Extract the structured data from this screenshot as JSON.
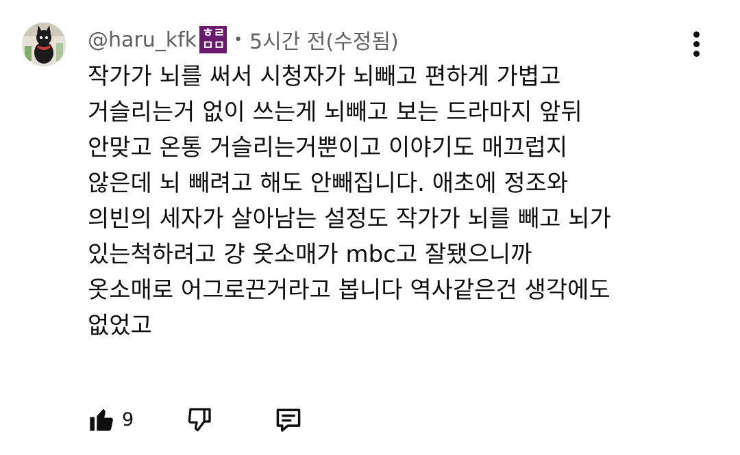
{
  "comment": {
    "author": "@haru_kfk",
    "badge": [
      "ㅎㄹ",
      "ㅁㅁ"
    ],
    "separator": "•",
    "time": "5시간 전(수정됨)",
    "lines": [
      "작가가 뇌를 써서 시청자가 뇌빼고 편하게 가볍고",
      "거슬리는거 없이 쓰는게 뇌빼고 보는 드라마지 앞뒤",
      "안맞고 온통 거슬리는거뿐이고 이야기도 매끄럽지",
      "않은데 뇌 빼려고 해도 안빼집니다. 애초에 정조와",
      "의빈의 세자가 살아남는 설정도 작가가 뇌를 빼고 뇌가",
      "있는척하려고 걍 옷소매가 mbc고 잘됐으니까",
      "옷소매로 어그로끈거라고 봅니다 역사같은건 생각에도",
      "없었고"
    ]
  },
  "actions": {
    "like_count": "9",
    "like_icon": "thumbs-up-icon",
    "dislike_icon": "thumbs-down-icon",
    "reply_icon": "reply-icon",
    "menu_icon": "more-vert-icon"
  },
  "colors": {
    "text": "#0f0f0f",
    "meta": "#606060",
    "badge": "#6a1b6e"
  }
}
